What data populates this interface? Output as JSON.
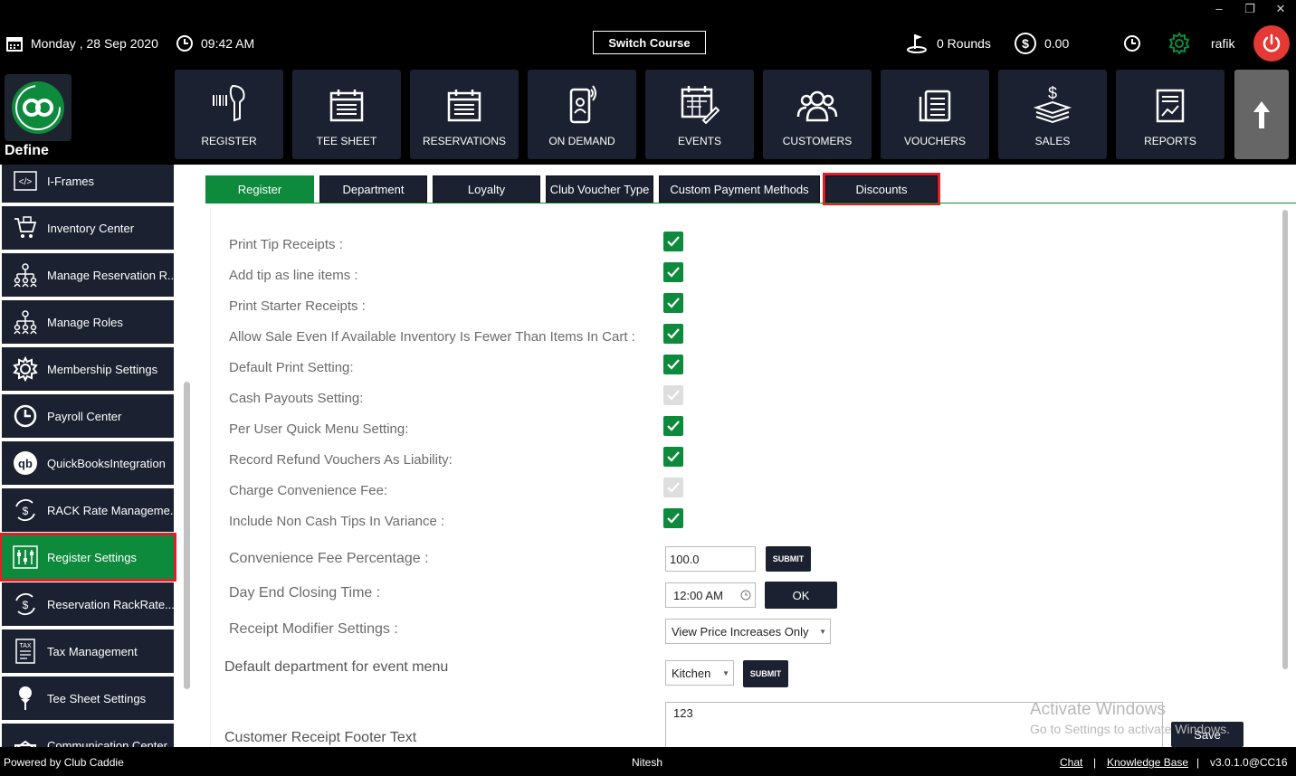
{
  "header": {
    "date": "Monday ,  28 Sep 2020",
    "time": "09:42 AM",
    "switch_course": "Switch Course",
    "rounds": "0 Rounds",
    "amount": "0.00",
    "user": "rafik"
  },
  "logo": {
    "label": "Define"
  },
  "main_nav": [
    {
      "label": "REGISTER",
      "icon": "barcode-scanner-icon"
    },
    {
      "label": "TEE SHEET",
      "icon": "calendar-list-icon"
    },
    {
      "label": "RESERVATIONS",
      "icon": "calendar-list-icon"
    },
    {
      "label": "ON DEMAND",
      "icon": "mobile-phone-icon"
    },
    {
      "label": "EVENTS",
      "icon": "calendar-edit-icon"
    },
    {
      "label": "CUSTOMERS",
      "icon": "users-icon"
    },
    {
      "label": "VOUCHERS",
      "icon": "voucher-icon"
    },
    {
      "label": "SALES",
      "icon": "money-stack-icon"
    },
    {
      "label": "REPORTS",
      "icon": "report-chart-icon"
    }
  ],
  "sidebar": {
    "items": [
      {
        "label": "I-Frames",
        "icon": "code-icon"
      },
      {
        "label": "Inventory Center",
        "icon": "cart-icon"
      },
      {
        "label": "Manage Reservation R...",
        "icon": "org-chart-icon"
      },
      {
        "label": "Manage Roles",
        "icon": "org-chart-icon"
      },
      {
        "label": "Membership Settings",
        "icon": "gear-icon"
      },
      {
        "label": "Payroll Center",
        "icon": "clock-icon"
      },
      {
        "label": "QuickBooksIntegration",
        "icon": "quickbooks-icon"
      },
      {
        "label": "RACK Rate Manageme...",
        "icon": "money-cycle-icon"
      },
      {
        "label": "Register Settings",
        "icon": "sliders-icon",
        "active": true
      },
      {
        "label": "Reservation RackRate...",
        "icon": "money-cycle-icon"
      },
      {
        "label": "Tax Management",
        "icon": "tax-icon"
      },
      {
        "label": "Tee Sheet Settings",
        "icon": "golf-tee-icon"
      },
      {
        "label": "Communication Center",
        "icon": "message-icon"
      }
    ]
  },
  "tabs": [
    {
      "label": "Register",
      "active": true
    },
    {
      "label": "Department"
    },
    {
      "label": "Loyalty"
    },
    {
      "label": "Club Voucher Type"
    },
    {
      "label": "Custom Payment Methods"
    },
    {
      "label": "Discounts",
      "highlighted": true
    }
  ],
  "settings": [
    {
      "label": "Print Tip Receipts :",
      "checked": true,
      "disabled": false
    },
    {
      "label": "Add tip as line items :",
      "checked": true,
      "disabled": false
    },
    {
      "label": "Print Starter Receipts :",
      "checked": true,
      "disabled": false
    },
    {
      "label": "Allow Sale Even If Available Inventory Is Fewer Than Items In Cart :",
      "checked": true,
      "disabled": false
    },
    {
      "label": "Default Print Setting:",
      "checked": true,
      "disabled": false
    },
    {
      "label": "Cash Payouts Setting:",
      "checked": true,
      "disabled": true
    },
    {
      "label": "Per User Quick Menu Setting:",
      "checked": true,
      "disabled": false
    },
    {
      "label": "Record Refund Vouchers As Liability:",
      "checked": true,
      "disabled": false
    },
    {
      "label": "Charge Convenience Fee:",
      "checked": true,
      "disabled": true
    },
    {
      "label": "Include Non Cash Tips In Variance :",
      "checked": true,
      "disabled": false
    }
  ],
  "convenience_fee": {
    "label": "Convenience Fee Percentage :",
    "value": "100.0",
    "button": "SUBMIT"
  },
  "day_end": {
    "label": "Day End Closing Time :",
    "value": "12:00 AM",
    "button": "OK"
  },
  "receipt_modifier": {
    "label": "Receipt Modifier Settings :",
    "value": "View Price Increases Only"
  },
  "event_dept": {
    "label": "Default department for event menu",
    "value": "Kitchen",
    "button": "SUBMIT"
  },
  "footer_text": {
    "label": "Customer Receipt Footer Text",
    "value": "123",
    "button": "Save"
  },
  "watermark": {
    "line1": "Activate Windows",
    "line2": "Go to Settings to activate Windows."
  },
  "footer": {
    "powered_by": "Powered by Club Caddie",
    "center_user": "Nitesh",
    "chat": "Chat",
    "separator": "|",
    "knowledge_base": "Knowledge Base",
    "version": "v3.0.1.0@CC16"
  },
  "colors": {
    "accent_green": "#0d8a3b",
    "dark_tile": "#1b2130",
    "highlight_red": "#e41e26",
    "power_red": "#e53935"
  }
}
